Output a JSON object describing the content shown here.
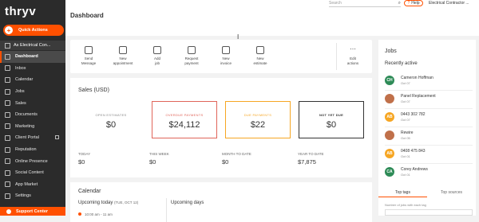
{
  "app": {
    "logo": "thryv"
  },
  "sidebar": {
    "quick_actions": "Quick Actions",
    "account": "As Electrical Con...",
    "items": [
      {
        "label": "Dashboard",
        "active": true
      },
      {
        "label": "Inbox"
      },
      {
        "label": "Calendar"
      },
      {
        "label": "Jobs"
      },
      {
        "label": "Sales"
      },
      {
        "label": "Documents"
      },
      {
        "label": "Marketing"
      },
      {
        "label": "Client Portal"
      },
      {
        "label": "Reputation"
      },
      {
        "label": "Online Presence"
      },
      {
        "label": "Social Content"
      },
      {
        "label": "App Market"
      },
      {
        "label": "Settings"
      }
    ],
    "support": "Support Center"
  },
  "topbar": {
    "search_placeholder": "Search",
    "help": "Help",
    "business_name": "Electrical Contractor ..."
  },
  "page_title": "Dashboard",
  "actions": [
    {
      "label1": "Send",
      "label2": "Message",
      "icon": "message-icon"
    },
    {
      "label1": "New",
      "label2": "appointment",
      "icon": "calendar-icon"
    },
    {
      "label1": "Add",
      "label2": "job",
      "icon": "person-add-icon"
    },
    {
      "label1": "Request",
      "label2": "payment",
      "icon": "payment-icon"
    },
    {
      "label1": "New",
      "label2": "invoice",
      "icon": "invoice-icon"
    },
    {
      "label1": "New",
      "label2": "estimate",
      "icon": "estimate-icon"
    }
  ],
  "edit_actions": {
    "label1": "Edit",
    "label2": "actions"
  },
  "sales": {
    "title": "Sales (USD)",
    "cards": [
      {
        "title": "OPEN ESTIMATES",
        "value": "$0",
        "color": "#ffffff",
        "border": "#ffffff",
        "title_color": "#888888"
      },
      {
        "title": "OVERDUE PAYMENTS",
        "value": "$24,112",
        "color": "#ffffff",
        "border": "#e0655a",
        "title_color": "#e0655a"
      },
      {
        "title": "DUE PAYMENTS",
        "value": "$22",
        "color": "#ffffff",
        "border": "#f6a623",
        "title_color": "#f6a623"
      },
      {
        "title": "NOT YET DUE",
        "value": "$0",
        "color": "#ffffff",
        "border": "#333333",
        "title_color": "#333333"
      }
    ],
    "stats": [
      {
        "label": "TODAY",
        "value": "$0"
      },
      {
        "label": "THIS WEEK",
        "value": "$0"
      },
      {
        "label": "MONTH TO DATE",
        "value": "$0"
      },
      {
        "label": "YEAR TO DATE",
        "value": "$7,875"
      }
    ]
  },
  "calendar": {
    "title": "Calendar",
    "upcoming_today": "Upcoming today",
    "today_date": "(TUE, OCT 12)",
    "upcoming_days": "Upcoming days",
    "event_time": "10:00 am - 11 am"
  },
  "jobs": {
    "title": "Jobs",
    "subtitle": "Recently active",
    "items": [
      {
        "initials": "CH",
        "name": "Cameron Hoffman",
        "date": "Oct 07",
        "color": "#2e8b57"
      },
      {
        "initials": "",
        "name": "Panel Replacement",
        "date": "Oct 07",
        "color": "#c0704a"
      },
      {
        "initials": "AB",
        "name": "0443 302 782",
        "date": "Oct 07",
        "color": "#f6a623"
      },
      {
        "initials": "",
        "name": "Rewire",
        "date": "Oct 05",
        "color": "#c0704a"
      },
      {
        "initials": "AB",
        "name": "0408 475 843",
        "date": "Oct 01",
        "color": "#f6a623"
      },
      {
        "initials": "CA",
        "name": "Corey Andrews",
        "date": "Oct 01",
        "color": "#2e8b57"
      }
    ],
    "tabs": [
      {
        "label": "Top tags",
        "active": true
      },
      {
        "label": "Top sources"
      }
    ],
    "footer": "Number of jobs with each tag"
  }
}
